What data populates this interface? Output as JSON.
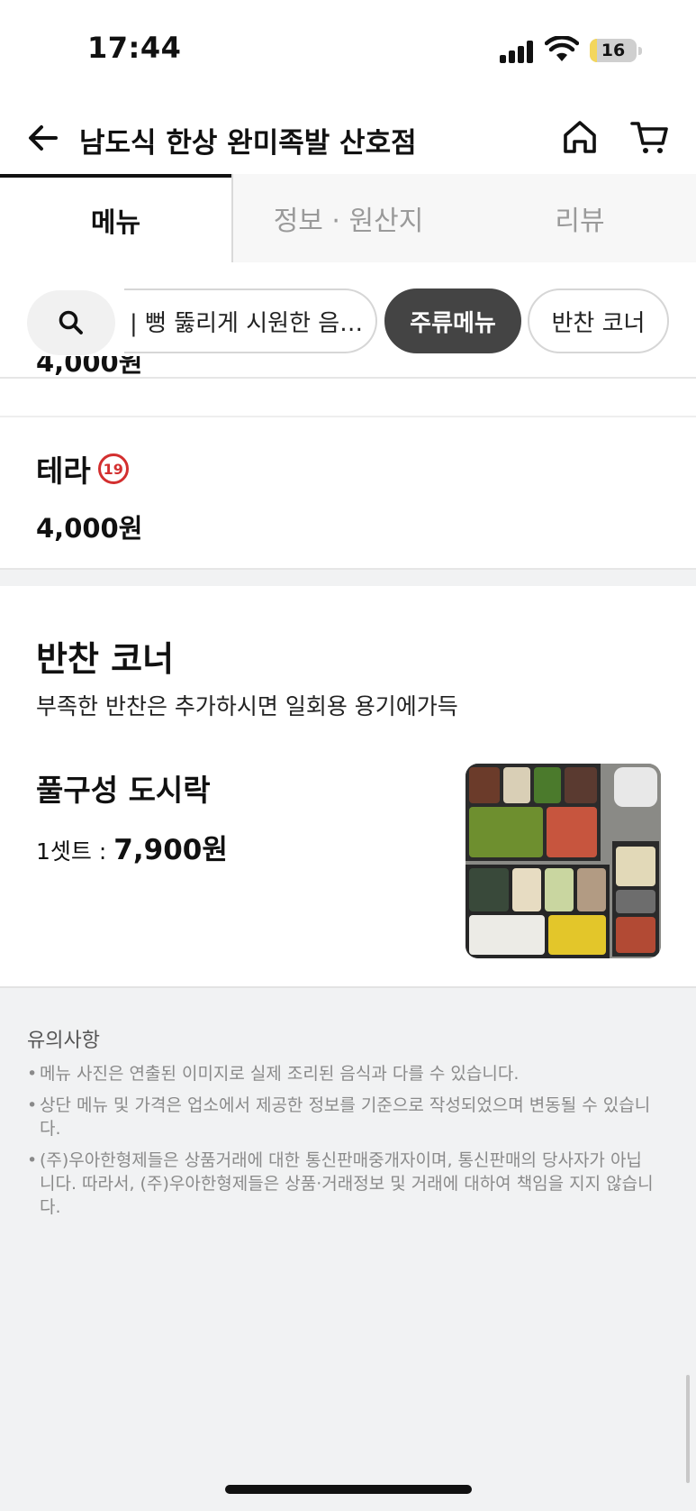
{
  "status_bar": {
    "time": "17:44",
    "battery": "16",
    "battery_level": 0.16
  },
  "header": {
    "title": "남도식 한상 완미족발 산호점"
  },
  "tabs": [
    {
      "label": "메뉴",
      "active": true
    },
    {
      "label": "정보 · 원산지",
      "active": false
    },
    {
      "label": "리뷰",
      "active": false
    }
  ],
  "chips": {
    "partial": "| 뻥 뚫리게 시원한 음…",
    "selected": "주류메뉴",
    "next": "반찬 코너"
  },
  "menu": {
    "cut_price": "4,000원",
    "items": [
      {
        "name": "테라",
        "age_badge": "19",
        "price": "4,000원"
      }
    ]
  },
  "section": {
    "title": "반찬 코너",
    "description": "부족한 반찬은 추가하시면 일회용 용기에가득",
    "set_item": {
      "name": "풀구성 도시락",
      "unit_label": "1셋트 :",
      "price": "7,900원"
    }
  },
  "notice": {
    "title": "유의사항",
    "items": [
      "메뉴 사진은 연출된 이미지로 실제 조리된 음식과 다를 수 있습니다.",
      "상단 메뉴 및 가격은 업소에서 제공한 정보를 기준으로 작성되었으며 변동될 수 있습니다.",
      "(주)우아한형제들은 상품거래에 대한 통신판매중개자이며, 통신판매의 당사자가 아닙니다. 따라서, (주)우아한형제들은 상품·거래정보 및 거래에 대하여 책임을 지지 않습니다."
    ]
  }
}
